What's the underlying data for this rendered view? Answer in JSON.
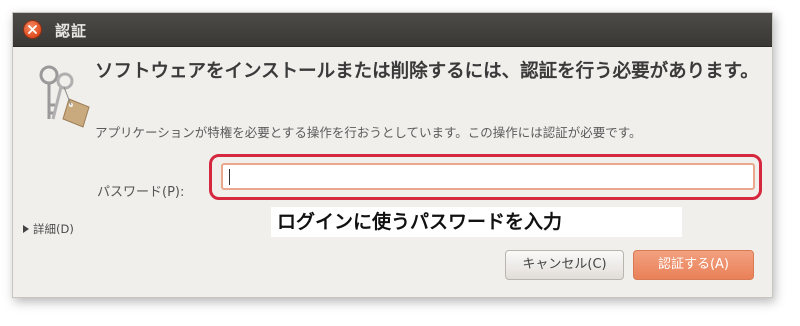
{
  "window": {
    "title": "認証"
  },
  "message": {
    "heading": "ソフトウェアをインストールまたは削除するには、認証を行う必要があります。",
    "description": "アプリケーションが特権を必要とする操作を行おうとしています。この操作には認証が必要です。"
  },
  "password": {
    "label": "パスワード(P):",
    "value": ""
  },
  "annotation": {
    "text": "ログインに使うパスワードを入力"
  },
  "details": {
    "label": "詳細(D)"
  },
  "buttons": {
    "cancel": "キャンセル(C)",
    "authenticate": "認証する(A)"
  },
  "colors": {
    "highlight": "#d5283e",
    "accent": "#e98058"
  },
  "icons": {
    "window_close": "close-icon",
    "auth": "keys-icon",
    "details_toggle": "triangle-right-icon"
  }
}
